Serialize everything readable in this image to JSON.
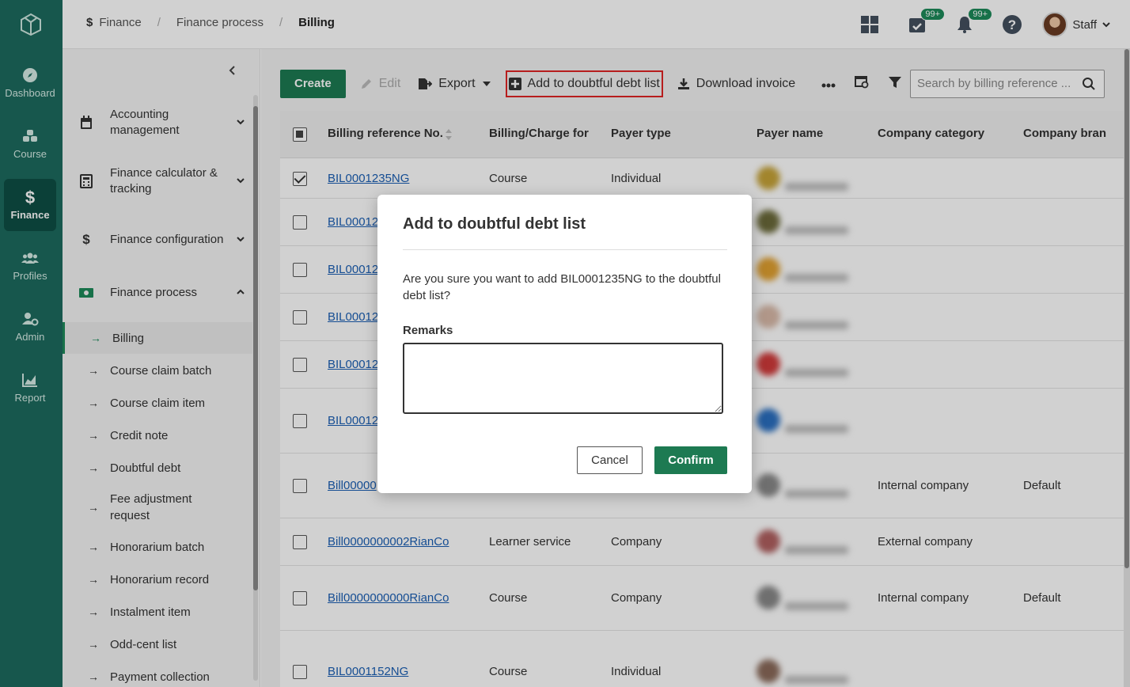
{
  "rail": {
    "items": [
      {
        "label": "Dashboard",
        "icon": "compass-icon"
      },
      {
        "label": "Course",
        "icon": "blocks-icon"
      },
      {
        "label": "Finance",
        "icon": "dollar-icon"
      },
      {
        "label": "Profiles",
        "icon": "people-icon"
      },
      {
        "label": "Admin",
        "icon": "user-gear-icon"
      },
      {
        "label": "Report",
        "icon": "chart-icon"
      }
    ]
  },
  "breadcrumb": {
    "items": [
      "Finance",
      "Finance process",
      "Billing"
    ],
    "separator": "/"
  },
  "topbar": {
    "tasks_badge": "99+",
    "notifications_badge": "99+",
    "user_name": "Staff"
  },
  "sidebar": {
    "groups": [
      {
        "label": "Accounting management"
      },
      {
        "label": "Finance calculator & tracking"
      },
      {
        "label": "Finance configuration"
      },
      {
        "label": "Finance process"
      }
    ],
    "subitems": [
      "Billing",
      "Course claim batch",
      "Course claim item",
      "Credit note",
      "Doubtful debt",
      "Fee adjustment request",
      "Honorarium batch",
      "Honorarium record",
      "Instalment item",
      "Odd-cent list",
      "Payment collection"
    ]
  },
  "toolbar": {
    "create": "Create",
    "edit": "Edit",
    "export": "Export",
    "add_doubtful": "Add to doubtful debt list",
    "download_invoice": "Download invoice",
    "search_placeholder": "Search by billing reference ..."
  },
  "table": {
    "columns": [
      "Billing reference No.",
      "Billing/Charge for",
      "Payer type",
      "Payer name",
      "Company category",
      "Company bran"
    ],
    "rows": [
      {
        "ref": "BIL0001235NG",
        "charge": "Course",
        "payer_type": "Individual",
        "category": "",
        "branch": "",
        "checked": true
      },
      {
        "ref": "BIL00012",
        "charge": "",
        "payer_type": "",
        "category": "",
        "branch": "",
        "checked": false
      },
      {
        "ref": "BIL00012",
        "charge": "",
        "payer_type": "",
        "category": "",
        "branch": "",
        "checked": false
      },
      {
        "ref": "BIL00012",
        "charge": "",
        "payer_type": "",
        "category": "",
        "branch": "",
        "checked": false
      },
      {
        "ref": "BIL00012",
        "charge": "",
        "payer_type": "",
        "category": "",
        "branch": "",
        "checked": false
      },
      {
        "ref": "BIL00012",
        "charge": "",
        "payer_type": "",
        "category": "",
        "branch": "",
        "checked": false
      },
      {
        "ref": "Bill00000",
        "charge": "",
        "payer_type": "",
        "category": "Internal company",
        "branch": "Default",
        "checked": false
      },
      {
        "ref": "Bill0000000002RianCo",
        "charge": "Learner service",
        "payer_type": "Company",
        "category": "External company",
        "branch": "",
        "checked": false
      },
      {
        "ref": "Bill0000000000RianCo",
        "charge": "Course",
        "payer_type": "Company",
        "category": "Internal company",
        "branch": "Default",
        "checked": false
      },
      {
        "ref": "BIL0001152NG",
        "charge": "Course",
        "payer_type": "Individual",
        "category": "",
        "branch": "",
        "checked": false
      }
    ]
  },
  "modal": {
    "title": "Add to doubtful debt list",
    "message": "Are you sure you want to add BIL0001235NG to the doubtful debt list?",
    "remarks_label": "Remarks",
    "remarks_value": "",
    "cancel": "Cancel",
    "confirm": "Confirm"
  },
  "colors": {
    "rail": "#1d6b5e",
    "primary": "#1d7a52",
    "link": "#1a5fb4",
    "highlight": "#e02424"
  }
}
